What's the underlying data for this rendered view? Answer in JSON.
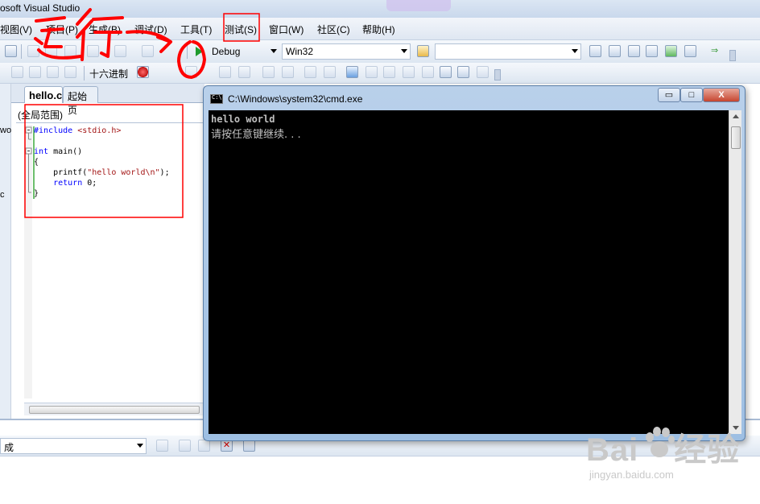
{
  "window": {
    "title": "osoft Visual Studio"
  },
  "menu": [
    "视图(V)",
    "项目(P)",
    "生成(B)",
    "调试(D)",
    "工具(T)",
    "测试(S)",
    "窗口(W)",
    "社区(C)",
    "帮助(H)"
  ],
  "toolbar1": {
    "config": "Debug",
    "platform": "Win32"
  },
  "toolbar2": {
    "hex_label": "十六进制"
  },
  "editor": {
    "tabs": [
      "hello.c",
      "起始页"
    ],
    "scope": "(全局范围)",
    "code": [
      "#include <stdio.h>",
      "",
      "int main()",
      "{",
      "    printf(\"hello world\\n\");",
      "    return 0;",
      "}"
    ]
  },
  "left_strip": [
    "wo",
    "c"
  ],
  "bottom": {
    "combo": "成"
  },
  "console": {
    "title": "C:\\Windows\\system32\\cmd.exe",
    "min": "▭",
    "max": "□",
    "close": "X",
    "line1": "hello world",
    "line2": "请按任意键继续. . ."
  },
  "watermark": {
    "brand": "Bai",
    "brand_cn": "经验",
    "url": "jingyan.baidu.com"
  },
  "colors": {
    "annotation": "#ff0000",
    "console_bg": "#000000",
    "console_text": "#c0c0c0"
  }
}
